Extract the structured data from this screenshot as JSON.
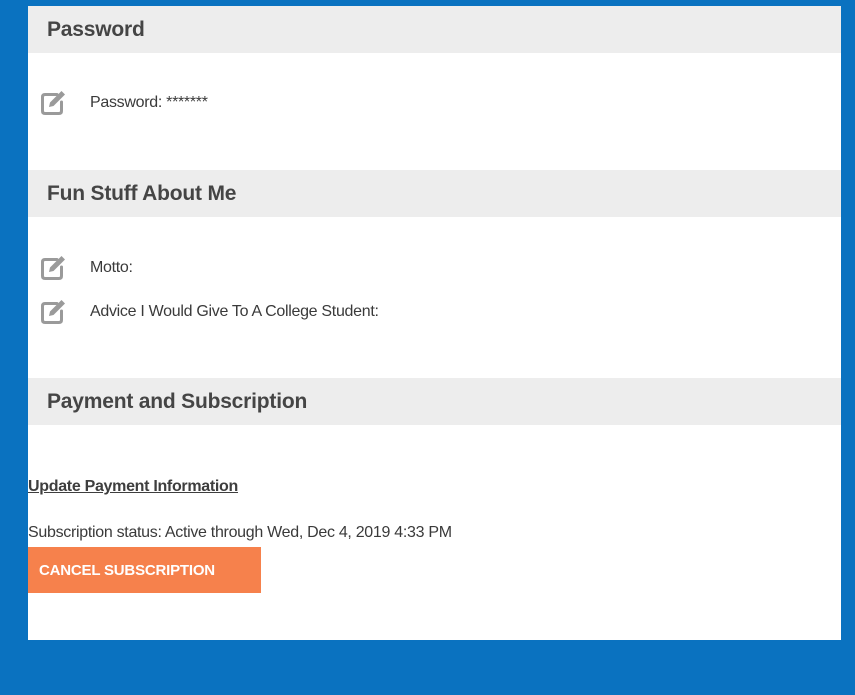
{
  "colors": {
    "page_background": "#0a72c0",
    "panel_background": "#ffffff",
    "section_header_background": "#ededed",
    "icon_color": "#9a9a9a",
    "cancel_button_background": "#f6814c",
    "cancel_button_text": "#ffffff"
  },
  "sections": {
    "password": {
      "title": "Password",
      "fields": [
        {
          "label": "Password: *******",
          "icon": "edit-icon"
        }
      ]
    },
    "fun_stuff": {
      "title": "Fun Stuff About Me",
      "fields": [
        {
          "label": "Motto:",
          "icon": "edit-icon"
        },
        {
          "label": "Advice I Would Give To A College Student:",
          "icon": "edit-icon"
        }
      ]
    },
    "payment": {
      "title": "Payment and Subscription",
      "update_link": "Update Payment Information",
      "status_text": "Subscription status: Active through Wed, Dec 4, 2019 4:33 PM",
      "cancel_label": "CANCEL SUBSCRIPTION"
    }
  }
}
